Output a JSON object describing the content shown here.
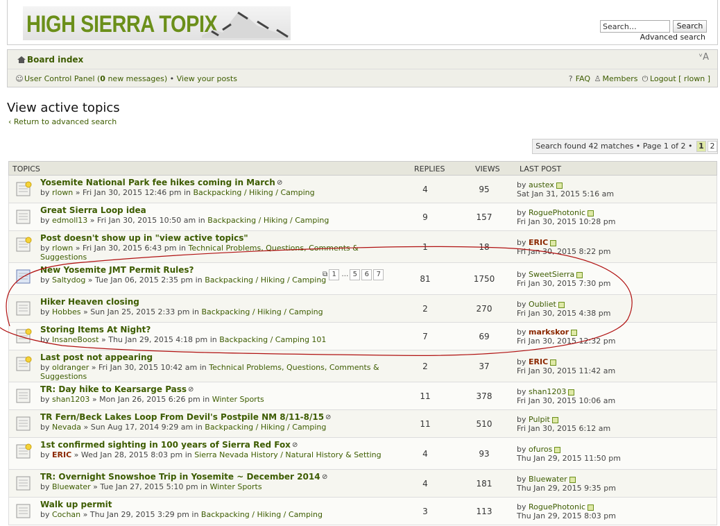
{
  "header": {
    "logo_text": "HIGH SIERRA TOPIX",
    "search_placeholder": "Search…",
    "search_button": "Search",
    "advanced_search": "Advanced search"
  },
  "nav": {
    "board_index": "Board index",
    "fontsize_icon": "font-size-icon",
    "ucp_prefix": "User Control Panel (",
    "ucp_count": "0",
    "ucp_suffix": " new messages)",
    "bullet": " • ",
    "view_posts": "View your posts",
    "faq": "FAQ",
    "members": "Members",
    "logout": "Logout [ rlown ]"
  },
  "page": {
    "title": "View active topics",
    "return_link": "Return to advanced search",
    "search_found": "Search found 42 matches • Page 1 of 2 •",
    "page_1": "1",
    "page_2": "2"
  },
  "table_head": {
    "topics": "TOPICS",
    "replies": "REPLIES",
    "views": "VIEWS",
    "last_post": "LAST POST"
  },
  "topics": [
    {
      "title": "Yosemite National Park fee hikes coming in March",
      "attach": true,
      "author": "rlown",
      "mod": false,
      "date": "Fri Jan 30, 2015 12:46 pm",
      "forum": "Backpacking / Hiking / Camping",
      "replies": "4",
      "views": "95",
      "lp_author": "austex",
      "lp_mod": false,
      "lp_date": "Sat Jan 31, 2015 5:16 am",
      "hot": true
    },
    {
      "title": "Great Sierra Loop idea",
      "attach": false,
      "author": "edmoll13",
      "mod": false,
      "date": "Fri Jan 30, 2015 10:50 am",
      "forum": "Backpacking / Hiking / Camping",
      "replies": "9",
      "views": "157",
      "lp_author": "RoguePhotonic",
      "lp_mod": false,
      "lp_date": "Fri Jan 30, 2015 10:28 pm",
      "hot": false
    },
    {
      "title": "Post doesn't show up in \"view active topics\"",
      "attach": false,
      "author": "rlown",
      "mod": false,
      "date": "Fri Jan 30, 2015 6:43 pm",
      "forum": "Technical Problems, Questions, Comments & Suggestions",
      "replies": "1",
      "views": "18",
      "lp_author": "ERIC",
      "lp_mod": true,
      "lp_date": "Fri Jan 30, 2015 8:22 pm",
      "hot": true
    },
    {
      "title": "New Yosemite JMT Permit Rules?",
      "attach": false,
      "author": "Saltydog",
      "mod": false,
      "date": "Tue Jan 06, 2015 2:35 pm",
      "forum": "Backpacking / Hiking / Camping",
      "replies": "81",
      "views": "1750",
      "lp_author": "SweetSierra",
      "lp_mod": false,
      "lp_date": "Fri Jan 30, 2015 7:30 pm",
      "hot": false,
      "pages": [
        "1",
        "…",
        "5",
        "6",
        "7"
      ]
    },
    {
      "title": "Hiker Heaven closing",
      "attach": false,
      "author": "Hobbes",
      "mod": false,
      "date": "Sun Jan 25, 2015 2:33 pm",
      "forum": "Backpacking / Hiking / Camping",
      "replies": "2",
      "views": "270",
      "lp_author": "Oubliet",
      "lp_mod": false,
      "lp_date": "Fri Jan 30, 2015 4:38 pm",
      "hot": false
    },
    {
      "title": "Storing Items At Night?",
      "attach": false,
      "author": "InsaneBoost",
      "mod": false,
      "date": "Thu Jan 29, 2015 4:18 pm",
      "forum": "Backpacking / Camping 101",
      "replies": "7",
      "views": "69",
      "lp_author": "markskor",
      "lp_mod": true,
      "lp_date": "Fri Jan 30, 2015 12:32 pm",
      "hot": true
    },
    {
      "title": "Last post not appearing",
      "attach": false,
      "author": "oldranger",
      "mod": false,
      "date": "Fri Jan 30, 2015 10:42 am",
      "forum": "Technical Problems, Questions, Comments & Suggestions",
      "replies": "2",
      "views": "37",
      "lp_author": "ERIC",
      "lp_mod": true,
      "lp_date": "Fri Jan 30, 2015 11:42 am",
      "hot": true
    },
    {
      "title": "TR: Day hike to Kearsarge Pass",
      "attach": true,
      "author": "shan1203",
      "mod": false,
      "date": "Mon Jan 26, 2015 6:26 pm",
      "forum": "Winter Sports",
      "replies": "11",
      "views": "378",
      "lp_author": "shan1203",
      "lp_mod": false,
      "lp_date": "Fri Jan 30, 2015 10:06 am",
      "hot": false
    },
    {
      "title": "TR Fern/Beck Lakes Loop From Devil's Postpile NM 8/11-8/15",
      "attach": true,
      "author": "Nevada",
      "mod": false,
      "date": "Sun Aug 17, 2014 9:29 am",
      "forum": "Backpacking / Hiking / Camping",
      "replies": "11",
      "views": "510",
      "lp_author": "Pulpit",
      "lp_mod": false,
      "lp_date": "Fri Jan 30, 2015 6:12 am",
      "hot": false
    },
    {
      "title": "1st confirmed sighting in 100 years of Sierra Red Fox",
      "attach": true,
      "author": "ERIC",
      "mod": true,
      "date": "Wed Jan 28, 2015 8:03 pm",
      "forum": "Sierra Nevada History / Natural History & Setting",
      "replies": "4",
      "views": "93",
      "lp_author": "ofuros",
      "lp_mod": false,
      "lp_date": "Thu Jan 29, 2015 11:50 pm",
      "hot": true
    },
    {
      "title": "TR: Overnight Snowshoe Trip in Yosemite ~ December 2014",
      "attach": true,
      "author": "Bluewater",
      "mod": false,
      "date": "Tue Jan 27, 2015 5:10 pm",
      "forum": "Winter Sports",
      "replies": "4",
      "views": "181",
      "lp_author": "Bluewater",
      "lp_mod": false,
      "lp_date": "Thu Jan 29, 2015 9:35 pm",
      "hot": false
    },
    {
      "title": "Walk up permit",
      "attach": false,
      "author": "Cochan",
      "mod": false,
      "date": "Thu Jan 29, 2015 3:29 pm",
      "forum": "Backpacking / Hiking / Camping",
      "replies": "3",
      "views": "113",
      "lp_author": "RoguePhotonic",
      "lp_mod": false,
      "lp_date": "Thu Jan 29, 2015 8:03 pm",
      "hot": false
    }
  ],
  "labels": {
    "by": "by ",
    "sep": " » ",
    "in": " in ",
    "attach_icon": "paperclip-icon"
  },
  "colors": {
    "link_green": "#3d5c00",
    "moderator": "#8b2800",
    "annotation_red": "#b01010"
  }
}
